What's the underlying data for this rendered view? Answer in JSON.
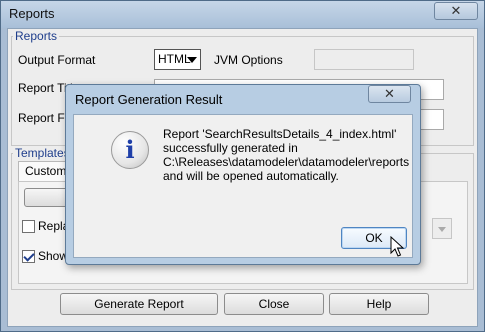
{
  "window": {
    "title": "Reports",
    "close_glyph": "✕"
  },
  "reports_group": {
    "legend": "Reports",
    "output_format_label": "Output Format",
    "output_format_value": "HTML",
    "jvm_options_label": "JVM Options",
    "jvm_options_value": "",
    "report_title_label": "Report Title",
    "report_title_value": "",
    "report_file_label": "Report File",
    "report_file_value": ""
  },
  "templates_group": {
    "legend": "Templates",
    "tab_custom": "Custom",
    "replace_label": "Replace",
    "replace_checked": false,
    "show_label": "Show",
    "show_checked": true
  },
  "buttons": {
    "generate": "Generate Report",
    "close": "Close",
    "help": "Help"
  },
  "dialog": {
    "title": "Report Generation Result",
    "close_glyph": "✕",
    "icon": "info-icon",
    "icon_glyph": "i",
    "message_lines": [
      "Report 'SearchResultsDetails_4_index.html'",
      "successfully generated in",
      "C:\\Releases\\datamodeler\\datamodeler\\reports",
      "and will be opened automatically."
    ],
    "ok_label": "OK"
  }
}
